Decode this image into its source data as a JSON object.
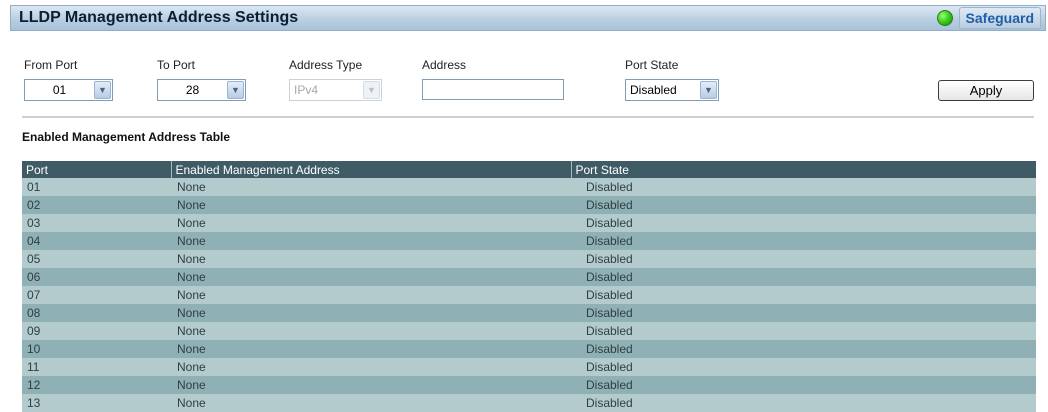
{
  "header": {
    "title": "LLDP Management Address Settings",
    "safeguard_label": "Safeguard",
    "status_color": "#3ad11e"
  },
  "form": {
    "from_port": {
      "label": "From Port",
      "value": "01"
    },
    "to_port": {
      "label": "To Port",
      "value": "28"
    },
    "address_type": {
      "label": "Address Type",
      "value": "IPv4"
    },
    "address": {
      "label": "Address",
      "value": ""
    },
    "port_state": {
      "label": "Port State",
      "value": "Disabled"
    },
    "apply_label": "Apply"
  },
  "table": {
    "title": "Enabled Management Address Table",
    "columns": [
      "Port",
      "Enabled Management Address",
      "Port State"
    ],
    "rows": [
      [
        "01",
        "None",
        "Disabled"
      ],
      [
        "02",
        "None",
        "Disabled"
      ],
      [
        "03",
        "None",
        "Disabled"
      ],
      [
        "04",
        "None",
        "Disabled"
      ],
      [
        "05",
        "None",
        "Disabled"
      ],
      [
        "06",
        "None",
        "Disabled"
      ],
      [
        "07",
        "None",
        "Disabled"
      ],
      [
        "08",
        "None",
        "Disabled"
      ],
      [
        "09",
        "None",
        "Disabled"
      ],
      [
        "10",
        "None",
        "Disabled"
      ],
      [
        "11",
        "None",
        "Disabled"
      ],
      [
        "12",
        "None",
        "Disabled"
      ],
      [
        "13",
        "None",
        "Disabled"
      ]
    ]
  }
}
